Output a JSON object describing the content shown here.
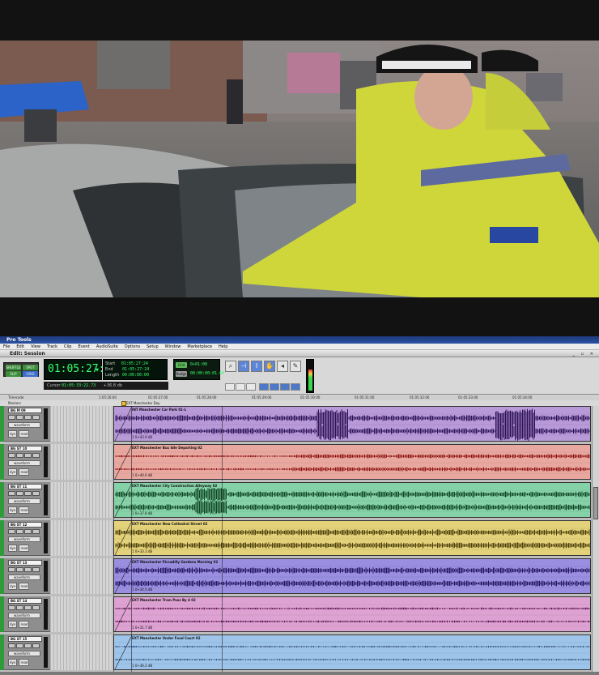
{
  "app": {
    "title": "Pro Tools",
    "window_title": "Edit: Session",
    "menus": [
      "File",
      "Edit",
      "View",
      "Track",
      "Clip",
      "Event",
      "AudioSuite",
      "Options",
      "Setup",
      "Window",
      "Marketplace",
      "Help"
    ]
  },
  "modes": [
    {
      "label": "SHUFFLE",
      "color": "#3b8f3b"
    },
    {
      "label": "SPOT",
      "color": "#3b8f3b"
    },
    {
      "label": "SLIP",
      "color": "#3b8f3b"
    },
    {
      "label": "GRID",
      "color": "#3b6dcc"
    }
  ],
  "counter": {
    "main": "01:05:27:24",
    "start_label": "Start",
    "start": "01:05:27:24",
    "end_label": "End",
    "end": "01:05:27:24",
    "length_label": "Length",
    "length": "00:00:00:00",
    "cursor_label": "Cursor",
    "cursor": "01:05:33:22.73",
    "cursor_value": "+36.8 db"
  },
  "grid": {
    "grid_label": "Grid",
    "grid_value": "0+01:00",
    "nudge_label": "Nudge",
    "nudge_value": "00:00:00:01.00"
  },
  "rulers": {
    "timecode_label": "Timecode",
    "markers_label": "Markers",
    "ticks": [
      {
        "label": "1:05:26:00",
        "pos": 0.09
      },
      {
        "label": "01:05:27:00",
        "pos": 0.18
      },
      {
        "label": "01:05:28:00",
        "pos": 0.27
      },
      {
        "label": "01:05:29:00",
        "pos": 0.37
      },
      {
        "label": "01:05:30:00",
        "pos": 0.46
      },
      {
        "label": "01:05:31:00",
        "pos": 0.56
      },
      {
        "label": "01:05:32:00",
        "pos": 0.66
      },
      {
        "label": "01:05:33:00",
        "pos": 0.75
      },
      {
        "label": "01:05:34:00",
        "pos": 0.85
      }
    ],
    "marker": "EXT Manchester Day"
  },
  "tracks": [
    {
      "name": "BG M 09",
      "view": "waveform",
      "auto": "read",
      "clip": "INT Manchester Car Park 01-L",
      "gain": "1  0+43.9 dB",
      "color": "#b89ad9",
      "wave": "#2d1257"
    },
    {
      "name": "BG ST 10",
      "view": "waveform",
      "auto": "read",
      "clip": "EXT Manchester Bus Idle Departing 02",
      "gain": "1  0+40.6 dB",
      "color": "#e8a8a0",
      "wave": "#8c1010"
    },
    {
      "name": "BG ST 11",
      "view": "waveform",
      "auto": "read",
      "clip": "EXT Manchester City Construction Alleyway 02",
      "gain": "1  0+37.8 dB",
      "color": "#86d2a8",
      "wave": "#0f4524"
    },
    {
      "name": "BG ST 12",
      "view": "waveform",
      "auto": "read",
      "clip": "EXT Manchester New Cathedral Street 02",
      "gain": "1  0+33.3 dB",
      "color": "#e4d27a",
      "wave": "#4a3d0a"
    },
    {
      "name": "BG ST 13",
      "view": "waveform",
      "auto": "read",
      "clip": "EXT Manchester Piccadilly Gardens Morning 02",
      "gain": "1  0+34.0 dB",
      "color": "#9a8ee0",
      "wave": "#241561"
    },
    {
      "name": "BG ST 14",
      "view": "waveform",
      "auto": "read",
      "clip": "EXT Manchester Tram Pass By 4 02",
      "gain": "1  0+31.7 dB",
      "color": "#dea2d2",
      "wave": "#5c1450"
    },
    {
      "name": "BG ST 15",
      "view": "waveform",
      "auto": "read",
      "clip": "EXT Manchester Under Food Court 02",
      "gain": "1  0+36.2 dB",
      "color": "#9ec4ea",
      "wave": "#213a66"
    }
  ]
}
